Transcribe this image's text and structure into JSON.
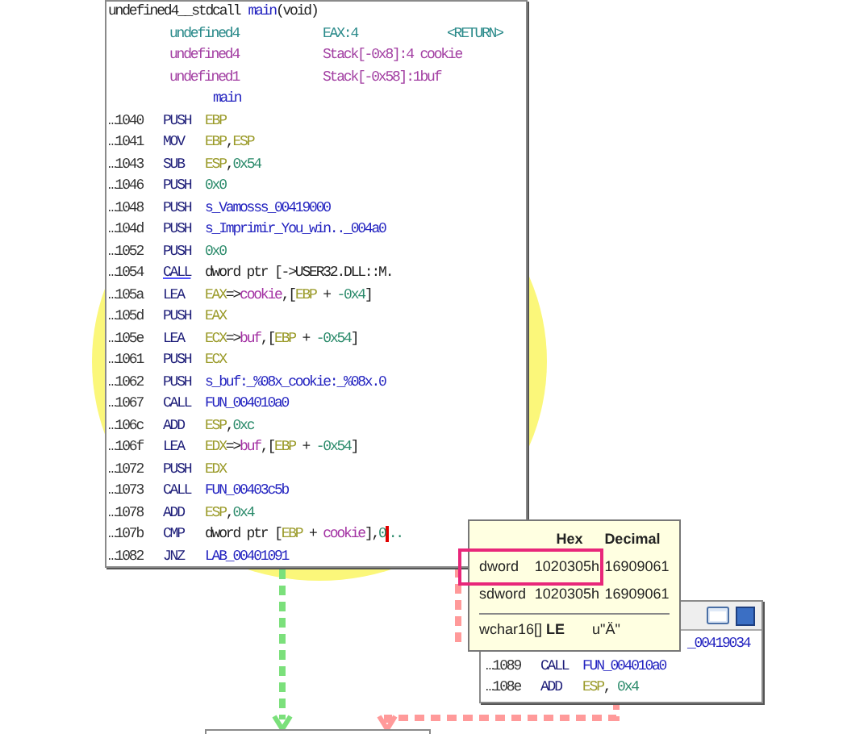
{
  "main_block": {
    "signature": [
      {
        "text": "undefined4__stdcall",
        "kind": "plain"
      },
      {
        "text": "main",
        "kind": "label"
      },
      {
        "text": "(void)",
        "kind": "plain"
      }
    ],
    "params": [
      {
        "kind": "return",
        "type": "undefined4",
        "storage": "EAX:4",
        "name": "<RETURN>"
      },
      {
        "kind": "local",
        "type": "undefined4",
        "storage": "Stack[-0x8]:4 cookie"
      },
      {
        "kind": "local",
        "type": "undefined1",
        "storage": "Stack[-0x58]:1buf"
      }
    ],
    "label": "main",
    "instructions": [
      {
        "address": "…1040",
        "mnemonic": "PUSH",
        "underlined": false,
        "operands": [
          {
            "text": "EBP",
            "kind": "register"
          }
        ]
      },
      {
        "address": "…1041",
        "mnemonic": "MOV",
        "underlined": false,
        "operands": [
          {
            "text": "EBP",
            "kind": "register"
          },
          {
            "text": ",",
            "kind": "plain"
          },
          {
            "text": "ESP",
            "kind": "register"
          }
        ]
      },
      {
        "address": "…1043",
        "mnemonic": "SUB",
        "underlined": false,
        "operands": [
          {
            "text": "ESP",
            "kind": "register"
          },
          {
            "text": ",",
            "kind": "plain"
          },
          {
            "text": "0x54",
            "kind": "number"
          }
        ]
      },
      {
        "address": "…1046",
        "mnemonic": "PUSH",
        "underlined": false,
        "operands": [
          {
            "text": "0x0",
            "kind": "number"
          }
        ]
      },
      {
        "address": "…1048",
        "mnemonic": "PUSH",
        "underlined": false,
        "operands": [
          {
            "text": "s_Vamosss_00419000",
            "kind": "label"
          }
        ]
      },
      {
        "address": "…104d",
        "mnemonic": "PUSH",
        "underlined": false,
        "operands": [
          {
            "text": "s_Imprimir_You_win.._004a0",
            "kind": "label"
          }
        ]
      },
      {
        "address": "…1052",
        "mnemonic": "PUSH",
        "underlined": false,
        "operands": [
          {
            "text": "0x0",
            "kind": "number"
          }
        ]
      },
      {
        "address": "…1054",
        "mnemonic": "CALL",
        "underlined": true,
        "operands": [
          {
            "text": "dword ptr [->USER32.DLL::M.",
            "kind": "plain"
          }
        ]
      },
      {
        "address": "…105a",
        "mnemonic": "LEA",
        "underlined": false,
        "operands": [
          {
            "text": "EAX",
            "kind": "register"
          },
          {
            "text": "=>",
            "kind": "plain"
          },
          {
            "text": "cookie",
            "kind": "variable"
          },
          {
            "text": ",[",
            "kind": "plain"
          },
          {
            "text": "EBP",
            "kind": "register"
          },
          {
            "text": " + ",
            "kind": "plain"
          },
          {
            "text": "-0x4",
            "kind": "number"
          },
          {
            "text": "]",
            "kind": "plain"
          }
        ]
      },
      {
        "address": "…105d",
        "mnemonic": "PUSH",
        "underlined": false,
        "operands": [
          {
            "text": "EAX",
            "kind": "register"
          }
        ]
      },
      {
        "address": "…105e",
        "mnemonic": "LEA",
        "underlined": false,
        "operands": [
          {
            "text": "ECX",
            "kind": "register"
          },
          {
            "text": "=>",
            "kind": "plain"
          },
          {
            "text": "buf",
            "kind": "variable"
          },
          {
            "text": ",[",
            "kind": "plain"
          },
          {
            "text": "EBP",
            "kind": "register"
          },
          {
            "text": " + ",
            "kind": "plain"
          },
          {
            "text": "-0x54",
            "kind": "number"
          },
          {
            "text": "]",
            "kind": "plain"
          }
        ]
      },
      {
        "address": "…1061",
        "mnemonic": "PUSH",
        "underlined": false,
        "operands": [
          {
            "text": "ECX",
            "kind": "register"
          }
        ]
      },
      {
        "address": "…1062",
        "mnemonic": "PUSH",
        "underlined": false,
        "operands": [
          {
            "text": "s_buf:_%08x_cookie:_%08x.0",
            "kind": "label"
          }
        ]
      },
      {
        "address": "…1067",
        "mnemonic": "CALL",
        "underlined": false,
        "operands": [
          {
            "text": "FUN_004010a0",
            "kind": "label"
          }
        ]
      },
      {
        "address": "…106c",
        "mnemonic": "ADD",
        "underlined": false,
        "operands": [
          {
            "text": "ESP",
            "kind": "register"
          },
          {
            "text": ",",
            "kind": "plain"
          },
          {
            "text": "0xc",
            "kind": "number"
          }
        ]
      },
      {
        "address": "…106f",
        "mnemonic": "LEA",
        "underlined": false,
        "operands": [
          {
            "text": "EDX",
            "kind": "register"
          },
          {
            "text": "=>",
            "kind": "plain"
          },
          {
            "text": "buf",
            "kind": "variable"
          },
          {
            "text": ",[",
            "kind": "plain"
          },
          {
            "text": "EBP",
            "kind": "register"
          },
          {
            "text": " + ",
            "kind": "plain"
          },
          {
            "text": "-0x54",
            "kind": "number"
          },
          {
            "text": "]",
            "kind": "plain"
          }
        ]
      },
      {
        "address": "…1072",
        "mnemonic": "PUSH",
        "underlined": false,
        "operands": [
          {
            "text": "EDX",
            "kind": "register"
          }
        ]
      },
      {
        "address": "…1073",
        "mnemonic": "CALL",
        "underlined": false,
        "operands": [
          {
            "text": "FUN_00403c5b",
            "kind": "label"
          }
        ]
      },
      {
        "address": "…1078",
        "mnemonic": "ADD",
        "underlined": false,
        "operands": [
          {
            "text": "ESP",
            "kind": "register"
          },
          {
            "text": ",",
            "kind": "plain"
          },
          {
            "text": "0x4",
            "kind": "number"
          }
        ]
      },
      {
        "address": "…107b",
        "mnemonic": "CMP",
        "underlined": false,
        "operands": [
          {
            "text": "dword ptr [",
            "kind": "plain"
          },
          {
            "text": "EBP",
            "kind": "register"
          },
          {
            "text": " + ",
            "kind": "plain"
          },
          {
            "text": "cookie",
            "kind": "variable"
          },
          {
            "text": "],",
            "kind": "plain"
          },
          {
            "text": "0",
            "kind": "number",
            "cursor": true
          },
          {
            "text": "..",
            "kind": "number"
          }
        ]
      },
      {
        "address": "…1082",
        "mnemonic": "JNZ",
        "underlined": false,
        "operands": [
          {
            "text": "LAB_00401091",
            "kind": "label"
          }
        ]
      }
    ]
  },
  "second_block": {
    "cut_text": "_00419034",
    "instructions": [
      {
        "address": "…1089",
        "mnemonic": "CALL",
        "underlined": false,
        "operands": [
          {
            "text": "FUN_004010a0",
            "kind": "label"
          }
        ]
      },
      {
        "address": "…108e",
        "mnemonic": "ADD",
        "underlined": false,
        "operands": [
          {
            "text": "ESP",
            "kind": "register"
          },
          {
            "text": ", ",
            "kind": "plain"
          },
          {
            "text": "0x4",
            "kind": "number"
          }
        ]
      }
    ]
  },
  "tooltip": {
    "columns": [
      "Hex",
      "Decimal"
    ],
    "rows": [
      {
        "type": "dword",
        "hex": "1020305h",
        "decimal": "16909061",
        "selected": true
      },
      {
        "type": "sdword",
        "hex": "1020305h",
        "decimal": "16909061",
        "selected": false
      }
    ],
    "string_row": {
      "type": "wchar16[]",
      "suffix": "LE",
      "value": "u\"Ä\""
    }
  }
}
